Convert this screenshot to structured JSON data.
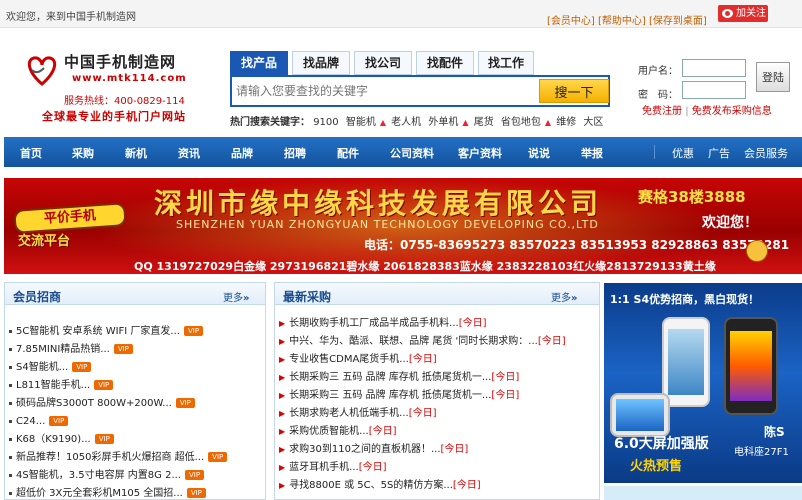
{
  "topbar": {
    "welcome": "欢迎您，来到中国手机制造网",
    "links": [
      "会员中心",
      "帮助中心",
      "保存到桌面"
    ],
    "follow": "加关注"
  },
  "logo": {
    "title": "中国手机制造网",
    "url": "www.mtk114.com",
    "hotline": "服务热线：400-0829-114",
    "slogan": "全球最专业的手机门户网站"
  },
  "search": {
    "tabs": [
      "找产品",
      "找品牌",
      "找公司",
      "找配件",
      "找工作"
    ],
    "placeholder": "请输入您要查找的关键字",
    "button": "搜一下",
    "hot_label": "热门搜索关键字：",
    "hot_words": [
      "9100",
      "智能机",
      "老人机",
      "外单机",
      "尾货",
      "省包地包",
      "维修",
      "大区"
    ]
  },
  "login": {
    "username_label": "用户名：",
    "password_label": "密　码：",
    "button": "登陆",
    "register": "免费注册",
    "post": "免费发布采购信息"
  },
  "nav": {
    "items": [
      "首页",
      "采购",
      "新机",
      "资讯",
      "品牌",
      "招聘",
      "配件",
      "公司资料",
      "客户资料",
      "说说",
      "举报"
    ],
    "right": [
      "优惠",
      "广告",
      "会员服务"
    ]
  },
  "banner": {
    "company": "深圳市缘中缘科技发展有限公司",
    "english": "SHENZHEN YUAN ZHONGYUAN TECHNOLOGY DEVELOPING CO.,LTD",
    "badge1": "平价手机",
    "badge2": "交流平台",
    "promo": "赛格38楼3888",
    "welcome": "欢迎您！",
    "phone": "电话：0755-83695273 83570223 83513953 82928863 83570281",
    "qq": "QQ 1319727029白金缘 2973196821碧水缘 2061828383蓝水缘 2383228103红火缘2813729133黄土缘"
  },
  "members": {
    "title": "会员招商",
    "more": "更多",
    "vip_label": "VIP",
    "items": [
      "5C智能机 安卓系统 WIFI 厂家直发...",
      "7.85MINI精品热销...",
      "S4智能机...",
      "L811智能手机...",
      "硕码品牌S3000T 800W+200W...",
      "C24...",
      "K68（K9190)...",
      "新品推荐！1050彩屏手机火爆招商 超低...",
      "4S智能机，3.5寸电容屏 内置8G 2...",
      "超低价 3X元全套彩机M105 全国招..."
    ]
  },
  "latest": {
    "title": "最新采购",
    "more": "更多",
    "today_label": "[今日]",
    "items": [
      "长期收购手机工厂成品半成品手机料...",
      "中兴、华为、酷派、联想、品牌 尾货 '同时长期求购：...",
      "专业收售CDMA尾货手机...",
      "长期采购三 五码 品牌 库存机 抵债尾货机一...",
      "长期采购三 五码 品牌 库存机 抵债尾货机一...",
      "长期求购老人机低端手机...",
      "采购优质智能机...",
      "求购30到110之间的直板机器！...",
      "蓝牙耳机手机...",
      "寻找8800E 或 5C、5S的精仿方案..."
    ]
  },
  "sidead": {
    "top": "1:1 S4优势招商，黑白现货！",
    "big": "6.0大屏加强版",
    "hot": "火热预售",
    "name": "陈S",
    "loc": "电科座27F1"
  },
  "colors": {
    "nav_blue": "#1a58b3",
    "accent_red": "#cc0000",
    "vip_orange": "#ee6a00",
    "search_yellow": "#f5b000"
  }
}
